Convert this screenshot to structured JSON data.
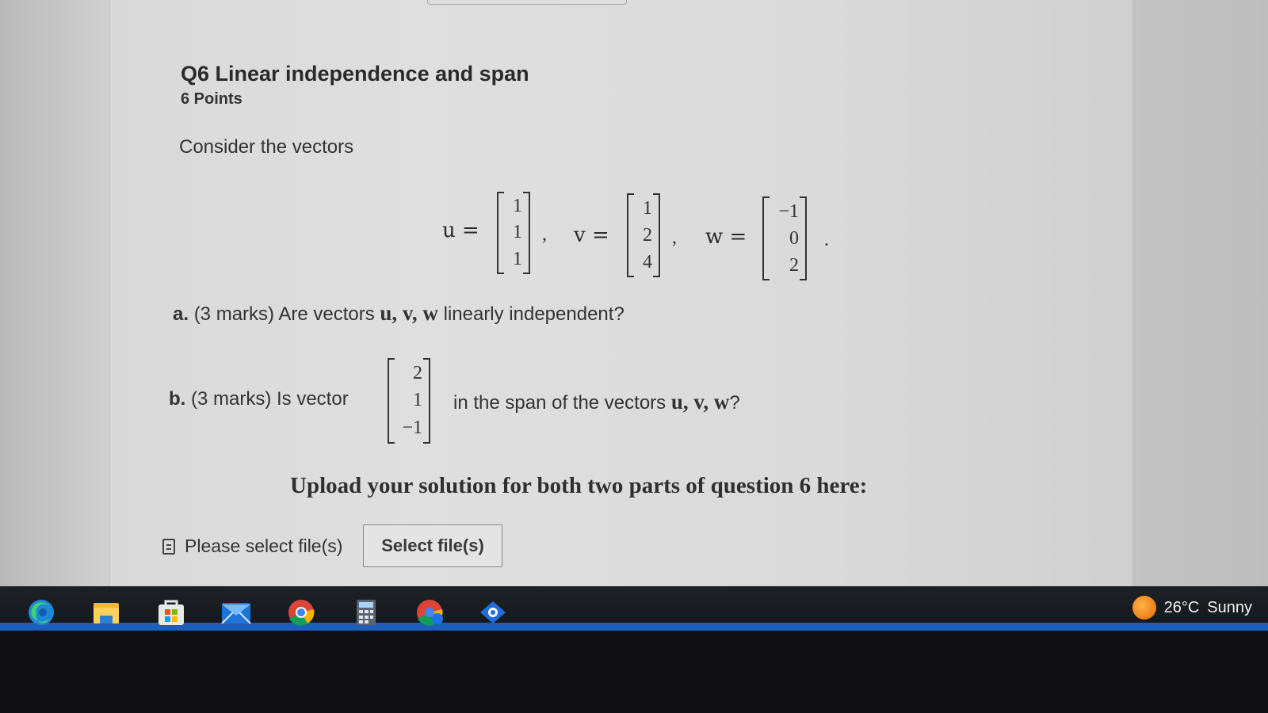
{
  "question": {
    "title": "Q6 Linear independence and span",
    "points": "6 Points",
    "intro": "Consider the vectors"
  },
  "vectors": {
    "u": {
      "label": "u =",
      "entries": [
        "1",
        "1",
        "1"
      ]
    },
    "v": {
      "label": "v =",
      "entries": [
        "1",
        "2",
        "4"
      ]
    },
    "w": {
      "label": "w =",
      "entries": [
        "−1",
        "0",
        "2"
      ]
    },
    "separator": ",",
    "end": "."
  },
  "part_a": {
    "label": "a.",
    "text_before": "(3 marks) Are vectors",
    "vars": "u, v, w",
    "text_after": "linearly independent?"
  },
  "part_b": {
    "label": "b.",
    "text_before": "(3 marks) Is  vector",
    "vector_entries": [
      "2",
      "1",
      "−1"
    ],
    "text_after": "in the span of the vectors",
    "vars": "u, v, w",
    "end": "?"
  },
  "upload": {
    "heading": "Upload your solution for both two parts of question 6 here:",
    "status": "Please select file(s)",
    "button_label": "Select file(s)"
  },
  "taskbar": {
    "icons": [
      "edge-icon",
      "file-explorer-icon",
      "store-icon",
      "mail-icon",
      "chrome-icon",
      "calculator-icon",
      "chrome-profile-icon",
      "app-icon"
    ],
    "weather": {
      "temp": "26°C",
      "condition": "Sunny"
    }
  },
  "colors": {
    "taskbar": "#1a1d21",
    "taskbar_accent": "#1d5fb8",
    "page": "#dcdcdc"
  }
}
